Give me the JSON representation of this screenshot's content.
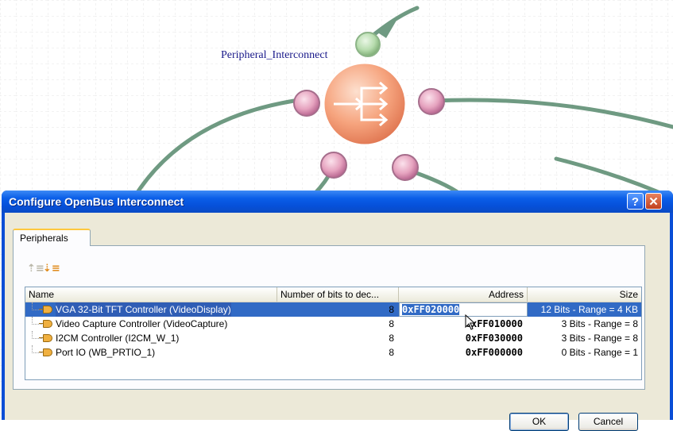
{
  "diagram": {
    "node_label": "Peripheral_Interconnect"
  },
  "dialog": {
    "title": "Configure OpenBus Interconnect",
    "help_label": "?",
    "close_label": "✕",
    "tab_label": "Peripherals",
    "toolbar": {
      "sort_asc_icon": "sort-ascending-icon",
      "sort_desc_icon": "sort-descending-icon"
    },
    "columns": {
      "name": "Name",
      "bits": "Number of bits to dec...",
      "address": "Address",
      "size": "Size"
    },
    "rows": [
      {
        "name": "VGA 32-Bit TFT Controller (VideoDisplay)",
        "bits": "8",
        "address": "0xFF020000",
        "size": "12 Bits - Range = 4 KB"
      },
      {
        "name": "Video Capture Controller (VideoCapture)",
        "bits": "8",
        "address": "0xFF010000",
        "size": "3 Bits - Range = 8"
      },
      {
        "name": "I2CM Controller (I2CM_W_1)",
        "bits": "8",
        "address": "0xFF030000",
        "size": "3 Bits - Range = 8"
      },
      {
        "name": "Port IO (WB_PRTIO_1)",
        "bits": "8",
        "address": "0xFF000000",
        "size": "0 Bits - Range = 1"
      }
    ],
    "ok_label": "OK",
    "cancel_label": "Cancel"
  },
  "colors": {
    "title_bar": "#0a5ee8",
    "selection": "#316ac5",
    "node_fill": "#f5a07a",
    "connector": "#6f9a82"
  }
}
